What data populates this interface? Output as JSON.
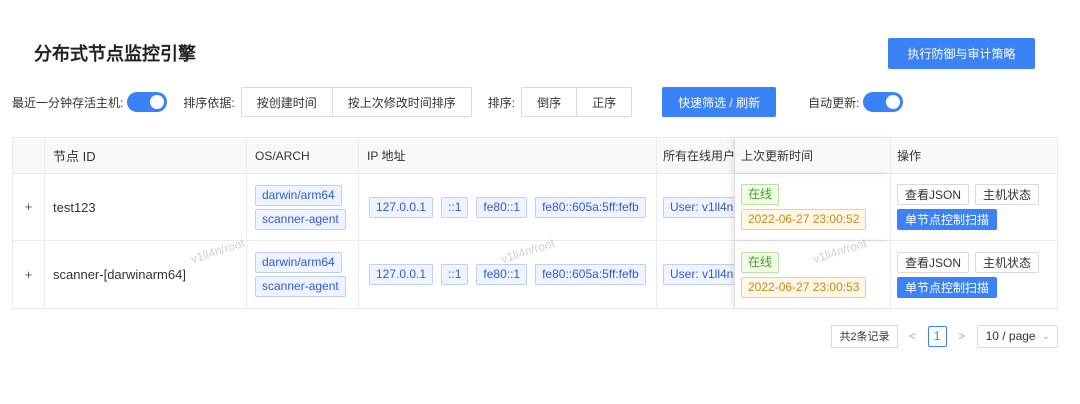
{
  "page": {
    "title": "分布式节点监控引擎",
    "audit_button": "执行防御与审计策略"
  },
  "toolbar": {
    "alive_label": "最近一分钟存活主机:",
    "alive_enabled": true,
    "sort_by_label": "排序依据:",
    "sort_by_options": [
      "按创建时间",
      "按上次修改时间排序"
    ],
    "order_label": "排序:",
    "order_options": [
      "倒序",
      "正序"
    ],
    "filter_button": "快速筛选 / 刷新",
    "auto_update_label": "自动更新:",
    "auto_update_enabled": true
  },
  "table": {
    "columns": [
      "",
      "节点 ID",
      "OS/ARCH",
      "IP 地址",
      "所有在线用户",
      "上次更新时间",
      "操作"
    ],
    "rows": [
      {
        "expand": "+",
        "id": "test123",
        "os": [
          "darwin/arm64",
          "scanner-agent"
        ],
        "ips": [
          "127.0.0.1",
          "::1",
          "fe80::1",
          "fe80::605a:5ff:fefb"
        ],
        "user": "User: v1ll4n",
        "status": "在线",
        "updated": "2022-06-27 23:00:52",
        "ops": [
          "查看JSON",
          "主机状态",
          "单节点控制扫描"
        ]
      },
      {
        "expand": "+",
        "id": "scanner-[darwinarm64]",
        "os": [
          "darwin/arm64",
          "scanner-agent"
        ],
        "ips": [
          "127.0.0.1",
          "::1",
          "fe80::1",
          "fe80::605a:5ff:fefb"
        ],
        "user": "User: v1ll4n",
        "status": "在线",
        "updated": "2022-06-27 23:00:53",
        "ops": [
          "查看JSON",
          "主机状态",
          "单节点控制扫描"
        ]
      }
    ]
  },
  "watermark": "v1ll4n/root",
  "pager": {
    "total": "共2条记录",
    "prev": "<",
    "current": "1",
    "next": ">",
    "page_size": "10 / page"
  },
  "colors": {
    "primary": "#3b82f6",
    "online": "#4aa21a",
    "timestamp": "#c98a1a"
  },
  "icons": {
    "expand": "plus-icon",
    "pager_prev": "chevron-left-icon",
    "pager_next": "chevron-right-icon",
    "page_size": "chevron-down-icon"
  }
}
